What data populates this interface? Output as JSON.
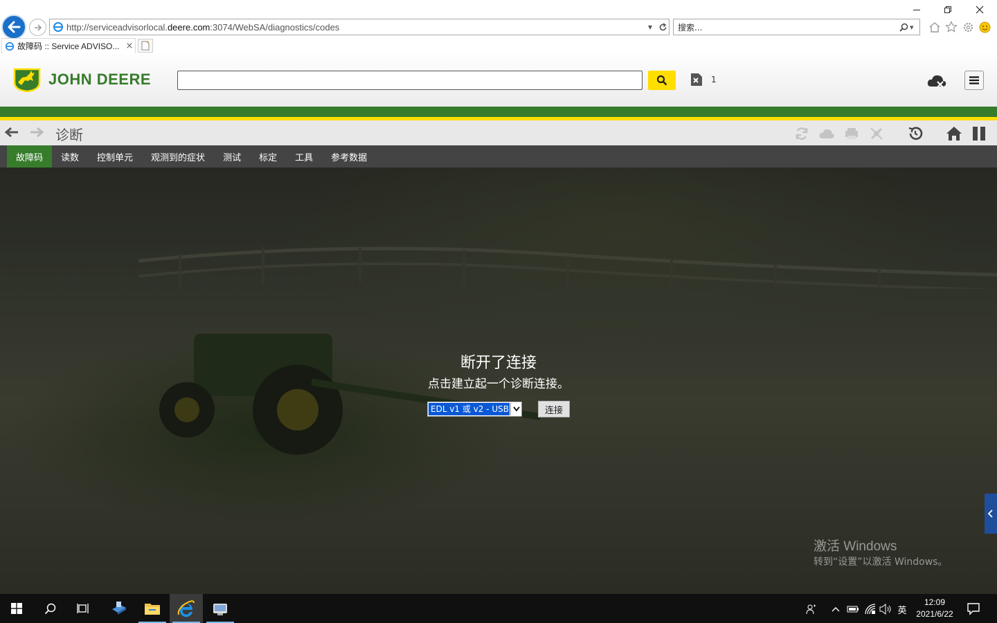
{
  "browser": {
    "url_prefix": "http://serviceadvisorlocal.",
    "url_domain": "deere.com",
    "url_suffix": ":3074/WebSA/diagnostics/codes",
    "search_placeholder": "搜索...",
    "tab_title": "故障码 :: Service ADVISO...",
    "tab_close": "×"
  },
  "app": {
    "brand": "JOHN DEERE",
    "brand_color": "#367c2b",
    "accent_yellow": "#ffde00",
    "docs_count": "1",
    "page_title": "诊断"
  },
  "menu": {
    "items": [
      {
        "label": "故障码",
        "active": true
      },
      {
        "label": "读数"
      },
      {
        "label": "控制单元"
      },
      {
        "label": "观测到的症状"
      },
      {
        "label": "测试"
      },
      {
        "label": "标定"
      },
      {
        "label": "工具"
      },
      {
        "label": "参考数据"
      }
    ]
  },
  "connection": {
    "status_title": "断开了连接",
    "status_sub": "点击建立起一个诊断连接。",
    "selected_adapter": "EDL v1 或 v2 - USB",
    "connect_label": "连接"
  },
  "watermark": {
    "line1": "激活 Windows",
    "line2": "转到“设置”以激活 Windows。"
  },
  "taskbar": {
    "time": "12:09",
    "date": "2021/6/22",
    "ime": "英"
  }
}
